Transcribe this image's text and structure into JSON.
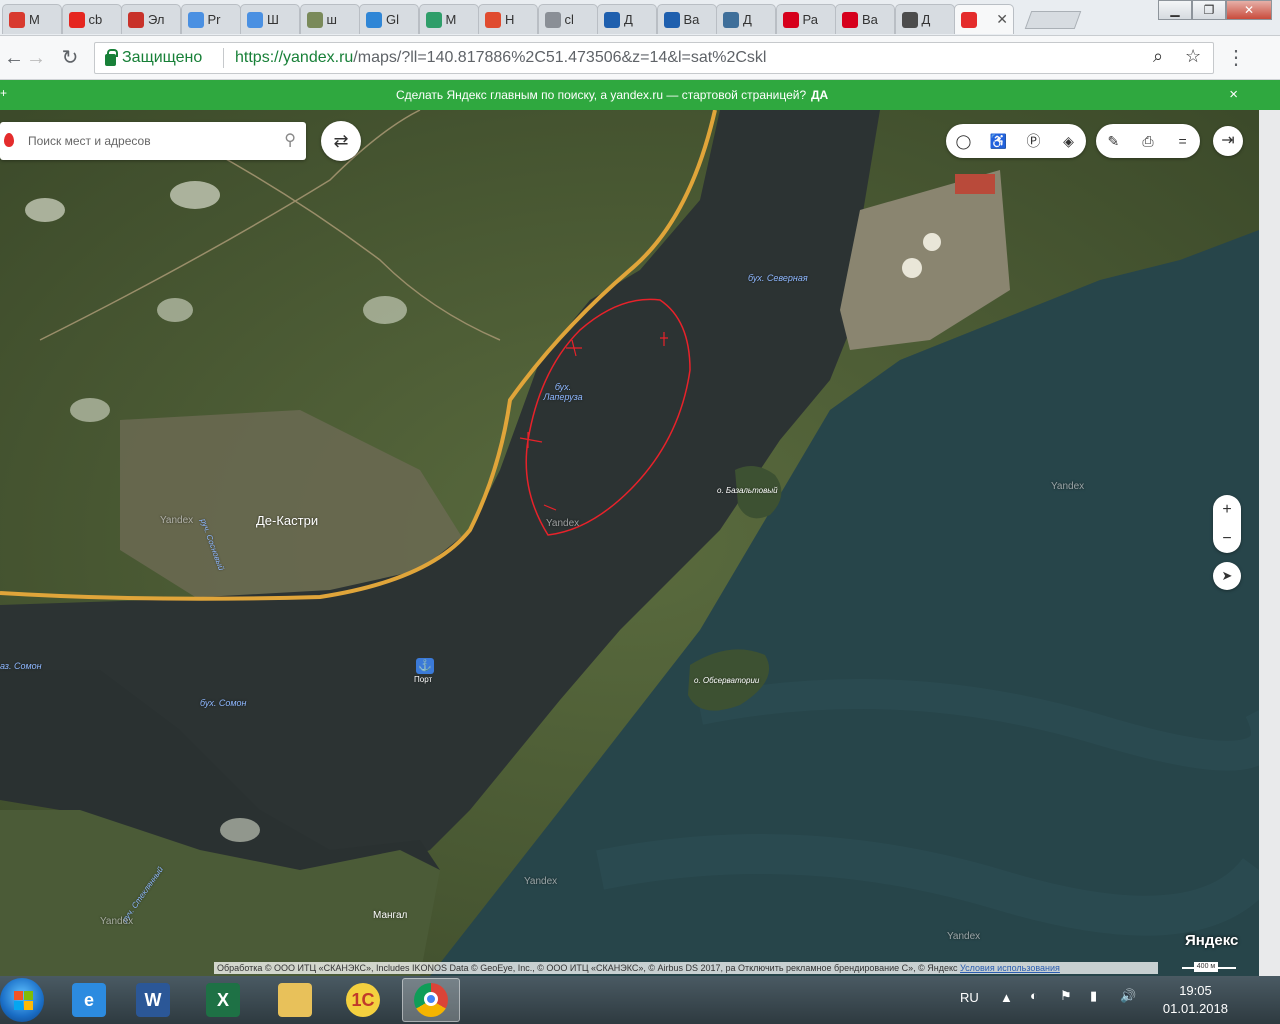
{
  "browser": {
    "tabs": [
      {
        "title": "М",
        "icon": "red-badge-icon",
        "color": "#d83a2f"
      },
      {
        "title": "cb",
        "icon": "yandex-ya-icon",
        "color": "#e52620"
      },
      {
        "title": "Эл",
        "icon": "red-circle-b-icon",
        "color": "#c8322a"
      },
      {
        "title": "Pr",
        "icon": "colorful-dots-icon",
        "color": "#4a90e2"
      },
      {
        "title": "Ш",
        "icon": "colorful-dots-icon",
        "color": "#4a90e2"
      },
      {
        "title": "ш",
        "icon": "route-map-icon",
        "color": "#7a8a5a"
      },
      {
        "title": "Gl",
        "icon": "drop-icon",
        "color": "#2f86d6"
      },
      {
        "title": "М",
        "icon": "green-triangle-icon",
        "color": "#2f9e6a"
      },
      {
        "title": "Н",
        "icon": "red-star-icon",
        "color": "#e04b2f"
      },
      {
        "title": "cl",
        "icon": "document-icon",
        "color": "#8a8f96"
      },
      {
        "title": "Д",
        "icon": "sj-icon",
        "color": "#1e5fae"
      },
      {
        "title": "Ва",
        "icon": "sj-icon",
        "color": "#1e5fae"
      },
      {
        "title": "Д",
        "icon": "globe-icon",
        "color": "#3f6f9a"
      },
      {
        "title": "Ра",
        "icon": "hh-icon",
        "color": "#d6001c"
      },
      {
        "title": "Ва",
        "icon": "hh-icon",
        "color": "#d6001c"
      },
      {
        "title": "Д",
        "icon": "af-icon",
        "color": "#4c4c4c"
      },
      {
        "title": "",
        "icon": "yandex-maps-pin-icon",
        "color": "#e42c2c",
        "active": true
      }
    ],
    "window_buttons": {
      "minimize": "▁",
      "restore": "❐",
      "close": "✕"
    },
    "secure_label": "Защищено",
    "url_host": "https://yandex.ru",
    "url_rest": "/maps/?ll=140.817886%2C51.473506&z=14&l=sat%2Cskl"
  },
  "promo": {
    "text": "Сделать Яндекс главным по поиску, а yandex.ru — стартовой страницей?",
    "yes_label": "ДА",
    "close": "×"
  },
  "map": {
    "search_placeholder": "Поиск мест и адресов",
    "labels": {
      "bay_north": "бух. Северная",
      "bay_laperuz": "бух.\nЛаперуза",
      "island_basalt": "о. Базальтовый",
      "island_observ": "о. Обсерватории",
      "town": "Де-Кастри",
      "bay_somon": "бух. Сомон",
      "bay_somon_left": "аз. Сомон",
      "port": "Порт",
      "mangal": "Мангал",
      "stream_sosnovy": "руч. Сосновый",
      "stream_steklyanny": "руч. Стеклянный",
      "watermark": "Yandex"
    },
    "attribution": "Обработка © ООО ИТЦ «СКАНЭКС», Includes IKONOS Data © GeoEye, Inc., © ООО ИТЦ «СКАНЭКС», © Airbus DS 2017, ра Отключить рекламное брендирование С», © Яндекс",
    "terms_link": "Условия использования",
    "logo": "Яндекс",
    "scale": "400 м",
    "zoom_in": "+",
    "zoom_out": "−",
    "colors": {
      "water": "#2c3333",
      "sea": "#27454a",
      "land": "#4d5c38",
      "road": "#e0a53a",
      "annotation": "#e8222a"
    }
  },
  "taskbar": {
    "apps": [
      {
        "name": "internet-explorer",
        "glyph": "e",
        "color": "#2c8be0"
      },
      {
        "name": "word",
        "glyph": "W",
        "color": "#2b5797"
      },
      {
        "name": "excel",
        "glyph": "X",
        "color": "#1e7145"
      },
      {
        "name": "explorer",
        "glyph": "",
        "color": "#e8c15a"
      },
      {
        "name": "1c",
        "glyph": "1С",
        "color": "#f4d03f"
      },
      {
        "name": "chrome",
        "glyph": "",
        "color": "#dddddd",
        "active": true
      }
    ],
    "lang": "RU",
    "time": "19:05",
    "date": "01.01.2018"
  }
}
